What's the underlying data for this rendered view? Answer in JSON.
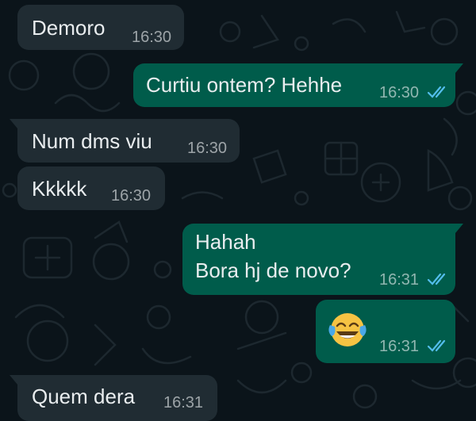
{
  "colors": {
    "background": "#0b141a",
    "incoming_bubble": "#202c33",
    "outgoing_bubble": "#005c4b",
    "text": "#e9edef",
    "read_ticks": "#53bdeb"
  },
  "messages": [
    {
      "direction": "incoming",
      "text": "Demoro",
      "time": "16:30"
    },
    {
      "direction": "outgoing",
      "text": "Curtiu ontem? Hehhe",
      "time": "16:30",
      "status": "read"
    },
    {
      "direction": "incoming",
      "text": "Num dms viu",
      "time": "16:30"
    },
    {
      "direction": "incoming",
      "text": "Kkkkk",
      "time": "16:30"
    },
    {
      "direction": "outgoing",
      "text_lines": [
        "Hahah",
        "Bora hj de novo?"
      ],
      "time": "16:31",
      "status": "read"
    },
    {
      "direction": "outgoing",
      "emoji": "face-with-tears-of-joy",
      "time": "16:31",
      "status": "read"
    },
    {
      "direction": "incoming",
      "text": "Quem dera",
      "time": "16:31"
    }
  ]
}
